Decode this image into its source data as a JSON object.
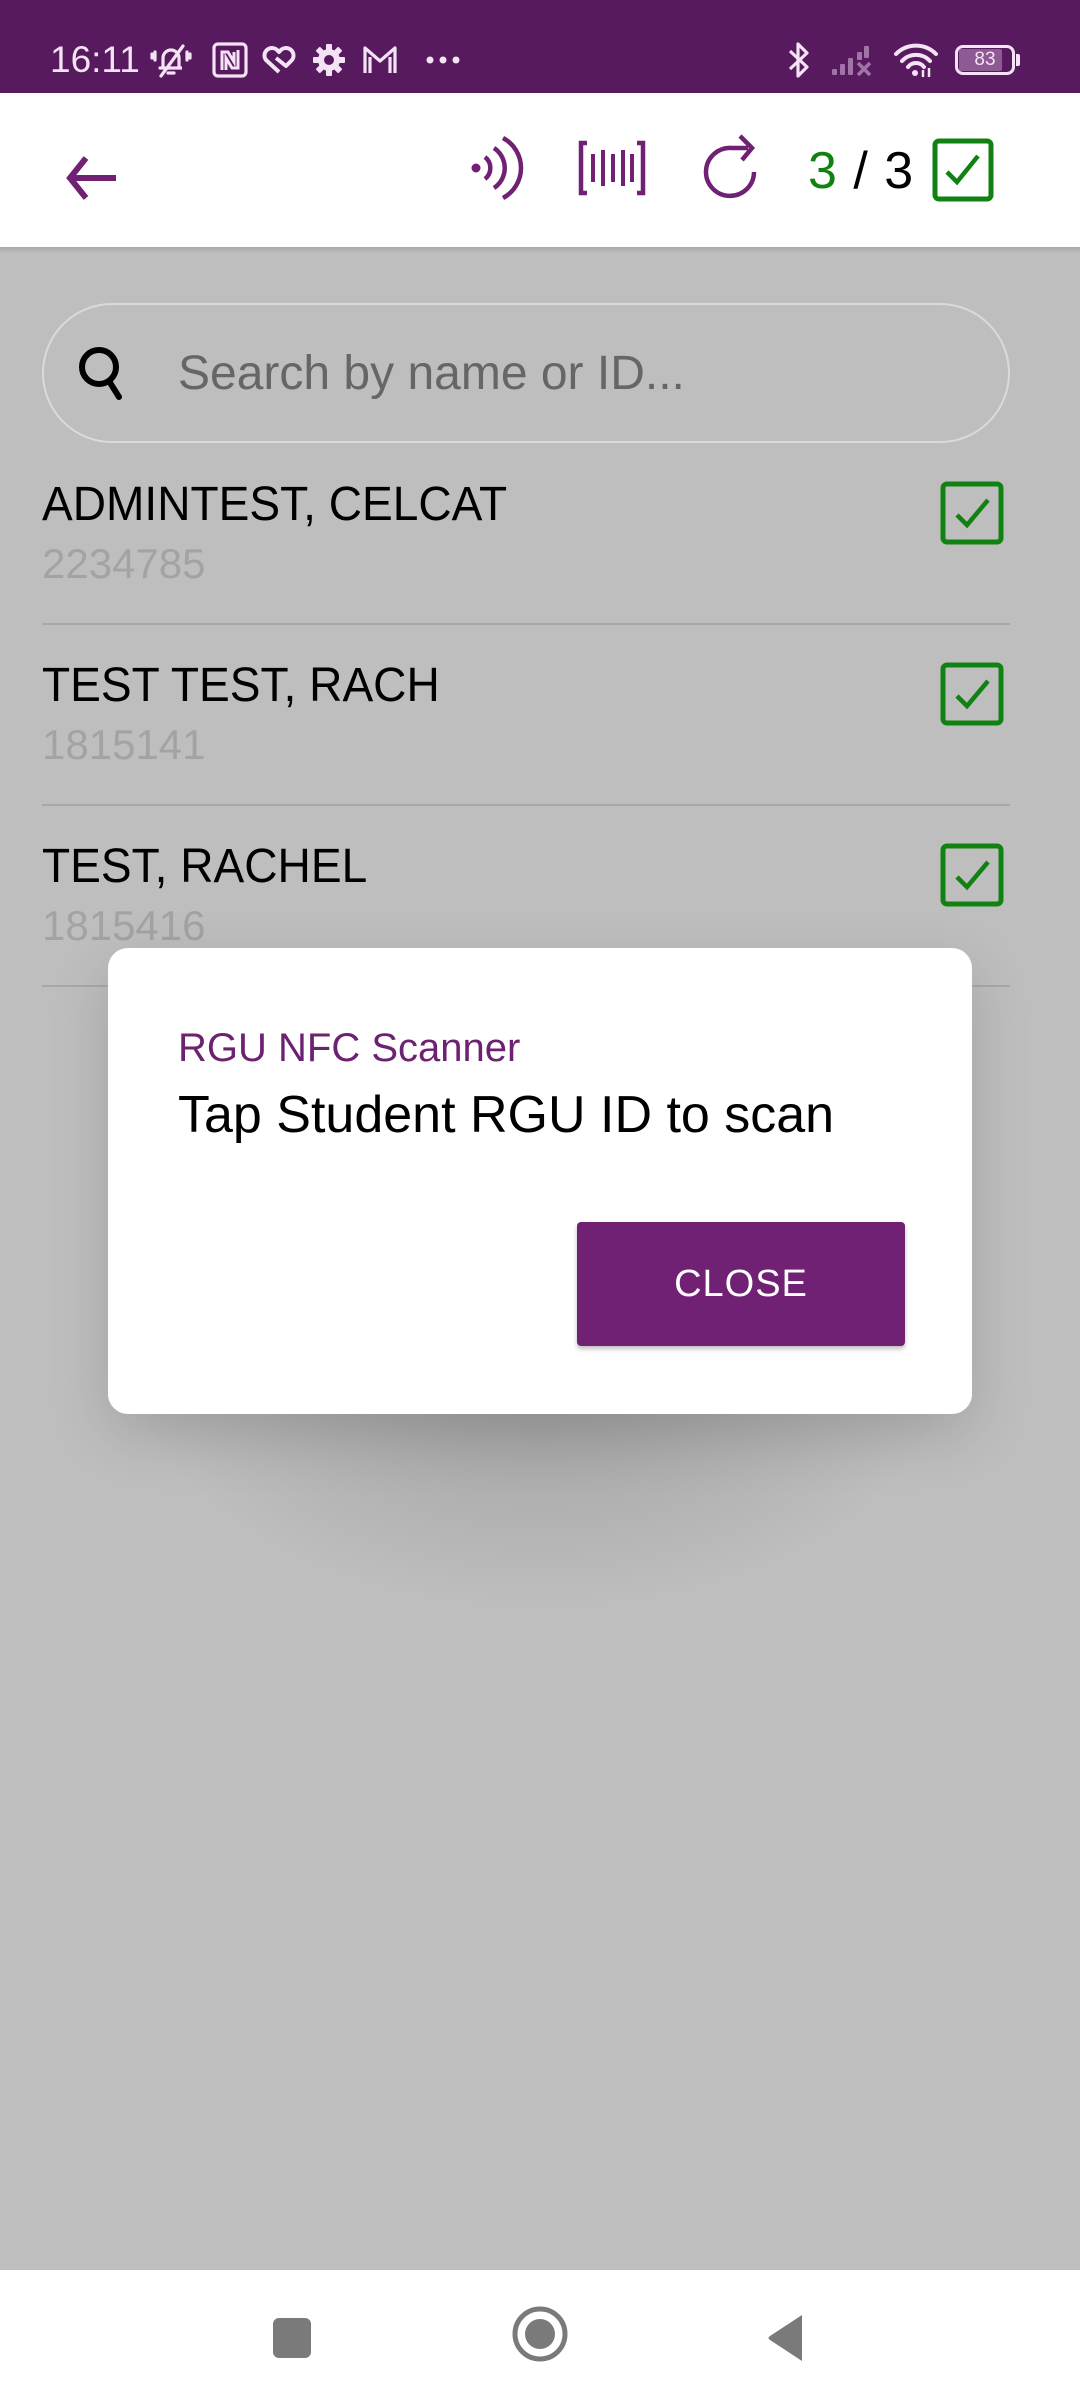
{
  "status_bar": {
    "time": "16:11",
    "left_icons": [
      "silent-mode-icon",
      "nfc-icon",
      "health-app-icon",
      "settings-icon",
      "gmail-icon",
      "more-notifications-icon"
    ],
    "right_icons": [
      "bluetooth-icon",
      "cellular-no-signal-icon",
      "wifi-icon",
      "battery-icon"
    ],
    "battery_level": "83",
    "battery_percent": 83
  },
  "app_bar": {
    "back_icon": "arrow-back-icon",
    "actions": [
      "nfc-scan-icon",
      "barcode-scan-icon",
      "refresh-icon"
    ],
    "counter": {
      "scanned": "3",
      "separator": "/",
      "total": "3"
    },
    "select_all_checked": true
  },
  "search": {
    "placeholder": "Search by name or ID...",
    "value": ""
  },
  "students": [
    {
      "name": "ADMINTEST, CELCAT",
      "id": "2234785",
      "checked": true
    },
    {
      "name": "TEST TEST, RACH",
      "id": "1815141",
      "checked": true
    },
    {
      "name": "TEST, RACHEL",
      "id": "1815416",
      "checked": true
    }
  ],
  "dialog": {
    "title": "RGU NFC Scanner",
    "message": "Tap Student RGU ID to scan",
    "close_label": "CLOSE"
  },
  "nav_bar": {
    "buttons": [
      "recent-apps-icon",
      "home-icon",
      "back-icon"
    ]
  },
  "colors": {
    "brand_purple": "#702174",
    "status_bar": "#581a5e",
    "check_green": "#118211",
    "scrim": "#bebebe"
  }
}
